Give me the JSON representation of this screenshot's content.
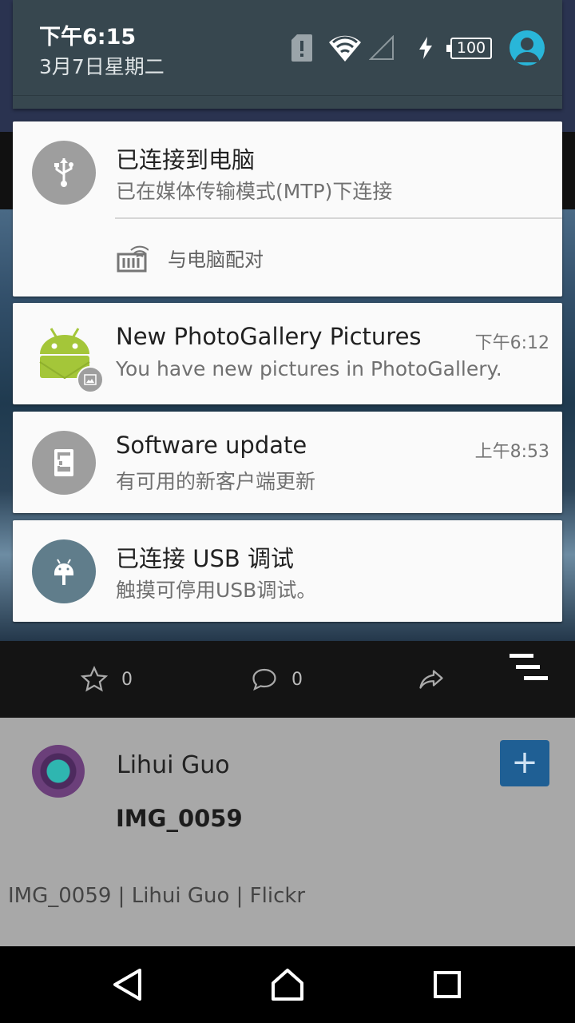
{
  "status": {
    "time": "下午6:15",
    "date": "3月7日星期二",
    "battery": "100"
  },
  "notifications": [
    {
      "title": "已连接到电脑",
      "text": "已在媒体传输模式(MTP)下连接",
      "action": "与电脑配对",
      "icon": "usb-icon"
    },
    {
      "title": "New PhotoGallery Pictures",
      "text": "You have new pictures in PhotoGallery.",
      "time": "下午6:12",
      "icon": "android-icon"
    },
    {
      "title": "Software update",
      "text": "有可用的新客户端更新",
      "time": "上午8:53",
      "icon": "phone-update-icon"
    },
    {
      "title": "已连接 USB 调试",
      "text": "触摸可停用USB调试。",
      "icon": "android-debug-icon"
    }
  ],
  "background_app": {
    "favorites_count": "0",
    "comments_count": "0",
    "author": "Lihui Guo",
    "photo_title": "IMG_0059",
    "add_label": "+",
    "caption": "IMG_0059 | Lihui Guo | Flickr"
  },
  "colors": {
    "shade_header": "#37474f",
    "card": "#fafafa",
    "usb_icon_bg": "#9e9e9e",
    "debug_icon_bg": "#607d8b",
    "profile_icon": "#29b6d9"
  }
}
